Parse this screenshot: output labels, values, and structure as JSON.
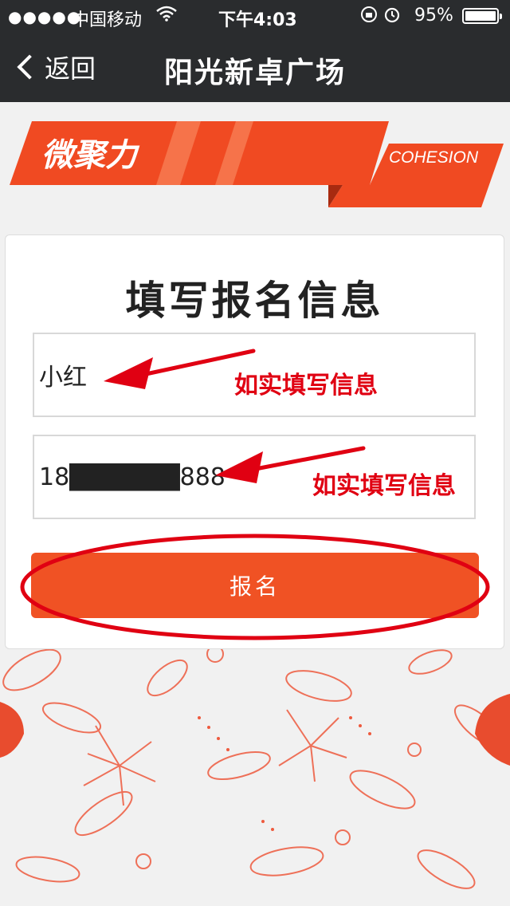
{
  "status_bar": {
    "signal": "●●●●●",
    "carrier": "中国移动",
    "time": "下午4:03",
    "battery": "95%",
    "battery_level": 0.95
  },
  "nav": {
    "back_label": "返回",
    "title": "阳光新卓广场"
  },
  "banner": {
    "logo_text": "微聚力",
    "tagline": "COHESION"
  },
  "form": {
    "title": "填写报名信息",
    "name_value": "小红",
    "phone_value": "18██████888",
    "submit_label": "报名"
  },
  "annotations": {
    "name_note": "如实填写信息",
    "phone_note": "如实填写信息"
  },
  "colors": {
    "accent": "#f05224",
    "annotation": "#e00012",
    "navbar": "#2a2c2e"
  }
}
